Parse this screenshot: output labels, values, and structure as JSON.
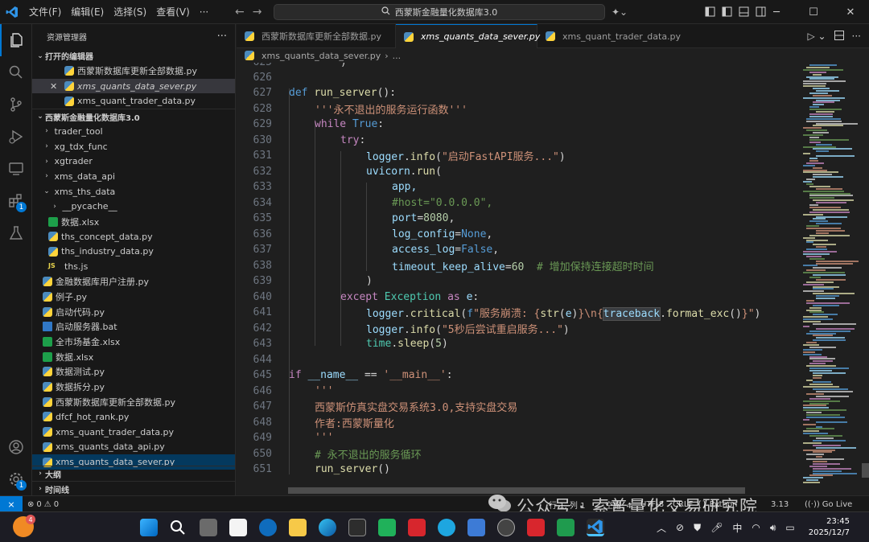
{
  "titlebar": {
    "menus": [
      "文件(F)",
      "编辑(E)",
      "选择(S)",
      "查看(V)",
      "···"
    ],
    "search_text": "西蒙斯金融量化数据库3.0"
  },
  "sidebar": {
    "title": "资源管理器",
    "open_editors_header": "打开的编辑器",
    "open_editors": [
      {
        "label": "西蒙斯数据库更新全部数据.py"
      },
      {
        "label": "xms_quants_data_sever.py"
      },
      {
        "label": "xms_quant_trader_data.py"
      }
    ],
    "workspace_header": "西蒙斯金融量化数据库3.0",
    "tree": [
      {
        "label": "trader_tool",
        "type": "folder"
      },
      {
        "label": "xg_tdx_func",
        "type": "folder"
      },
      {
        "label": "xgtrader",
        "type": "folder"
      },
      {
        "label": "xms_data_api",
        "type": "folder"
      },
      {
        "label": "xms_ths_data",
        "type": "folder-open"
      },
      {
        "label": "__pycache__",
        "type": "folder"
      },
      {
        "label": "数据.xlsx",
        "type": "xlsx"
      },
      {
        "label": "ths_concept_data.py",
        "type": "py"
      },
      {
        "label": "ths_industry_data.py",
        "type": "py"
      },
      {
        "label": "ths.js",
        "type": "js"
      },
      {
        "label": "金融数据库用户注册.py",
        "type": "py"
      },
      {
        "label": "例子.py",
        "type": "py"
      },
      {
        "label": "启动代码.py",
        "type": "py"
      },
      {
        "label": "启动服务器.bat",
        "type": "bat"
      },
      {
        "label": "全市场基金.xlsx",
        "type": "xlsx"
      },
      {
        "label": "数据.xlsx",
        "type": "xlsx"
      },
      {
        "label": "数据测试.py",
        "type": "py"
      },
      {
        "label": "数据拆分.py",
        "type": "py"
      },
      {
        "label": "西蒙斯数据库更新全部数据.py",
        "type": "py"
      },
      {
        "label": "dfcf_hot_rank.py",
        "type": "py"
      },
      {
        "label": "xms_quant_trader_data.py",
        "type": "py"
      },
      {
        "label": "xms_quants_data_api.py",
        "type": "py"
      },
      {
        "label": "xms_quants_data_sever.py",
        "type": "py"
      }
    ],
    "outline_header": "大纲",
    "timeline_header": "时间线"
  },
  "tabs": [
    {
      "label": "西蒙斯数据库更新全部数据.py"
    },
    {
      "label": "xms_quants_data_sever.py"
    },
    {
      "label": "xms_quant_trader_data.py"
    }
  ],
  "breadcrumb": {
    "file": "xms_quants_data_sever.py",
    "more": "..."
  },
  "editor": {
    "partial_line_number": "625",
    "line_numbers": [
      "626",
      "627",
      "628",
      "629",
      "630",
      "631",
      "632",
      "633",
      "634",
      "635",
      "636",
      "637",
      "638",
      "639",
      "640",
      "641",
      "642",
      "643",
      "644",
      "645",
      "646",
      "647",
      "648",
      "649",
      "650",
      "651"
    ],
    "code": {
      "l627_def": "def",
      "l627_name": "run_server",
      "l627_rest": "():",
      "l628": "'''永不退出的服务运行函数'''",
      "l629_kw": "while",
      "l629_true": "True",
      "l629_rest": ":",
      "l630_kw": "try",
      "l630_rest": ":",
      "l631_a": "logger",
      "l631_b": "info",
      "l631_str": "\"启动FastAPI服务...\"",
      "l632_a": "uvicorn",
      "l632_b": "run",
      "l633": "app,",
      "l634": "#host=\"0.0.0.0\",",
      "l635_k": "port",
      "l635_v": "8080",
      "l636_k": "log_config",
      "l636_v": "None",
      "l637_k": "access_log",
      "l637_v": "False",
      "l638_k": "timeout_keep_alive",
      "l638_v": "60",
      "l638_cmt": "# 增加保持连接超时时间",
      "l639": ")",
      "l640_kw": "except",
      "l640_cls": "Exception",
      "l640_as": "as",
      "l640_e": "e",
      "l641_a": "logger",
      "l641_b": "critical",
      "l641_f": "f",
      "l641_s1": "\"服务崩溃: {",
      "l641_str": "str",
      "l641_e": "e",
      "l641_s2": "}\\n{",
      "l641_tb": "traceback",
      "l641_fmt": "format_exc",
      "l641_s3": "}\"",
      "l642_a": "logger",
      "l642_b": "info",
      "l642_str": "\"5秒后尝试重启服务...\"",
      "l643_a": "time",
      "l643_b": "sleep",
      "l643_n": "5",
      "l645_if": "if",
      "l645_name": "__name__",
      "l645_str": "'__main__'",
      "l646": "'''",
      "l647": "西蒙斯仿真实盘交易系统3.0,支持实盘交易",
      "l648": "作者:西蒙斯量化",
      "l649": "'''",
      "l650": "# 永不退出的服务循环",
      "l651_fn": "run_server"
    }
  },
  "statusbar": {
    "errors": "0",
    "warnings": "0",
    "position": "行 1, 列 1",
    "spaces": "空格: 4",
    "encoding": "UTF-8",
    "eol": "CRLF",
    "language": "Python",
    "version": "3.13",
    "golive": "Go Live"
  },
  "watermark": {
    "text": "公众号 · 索普量化交易研究院"
  },
  "taskbar": {
    "weather_badge": "4",
    "tray_lang": "中",
    "time": "23:45",
    "date": "2025/12/7"
  },
  "badges": {
    "extensions": "1",
    "accounts": "1"
  },
  "colors": {
    "accent": "#0078d4",
    "background": "#1f1f1f"
  }
}
